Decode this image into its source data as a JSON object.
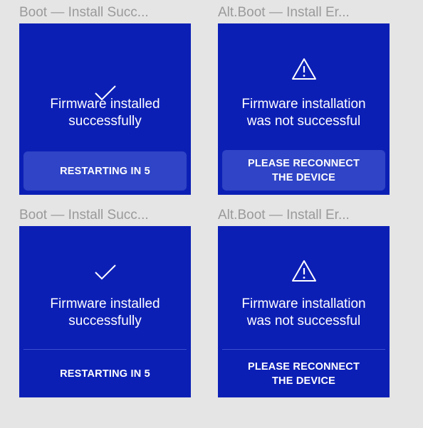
{
  "frames": [
    {
      "label": "Boot — Install Succ...",
      "icon": "checkmark-icon",
      "message_line1": "Firmware installed",
      "message_line2": "successfully",
      "action_line1": "RESTARTING IN 5",
      "action_line2": ""
    },
    {
      "label": "Alt.Boot — Install Er...",
      "icon": "warning-icon",
      "message_line1": "Firmware installation",
      "message_line2": "was not successful",
      "action_line1": "PLEASE RECONNECT",
      "action_line2": "THE DEVICE"
    },
    {
      "label": "Boot — Install Succ...",
      "icon": "checkmark-icon",
      "message_line1": "Firmware installed",
      "message_line2": "successfully",
      "action_line1": "RESTARTING IN 5",
      "action_line2": ""
    },
    {
      "label": "Alt.Boot — Install Er...",
      "icon": "warning-icon",
      "message_line1": "Firmware installation",
      "message_line2": "was not successful",
      "action_line1": "PLEASE RECONNECT",
      "action_line2": "THE DEVICE"
    }
  ],
  "colors": {
    "canvas": "#e5e5e5",
    "screen": "#0c1fb5",
    "button": "#2f44c6",
    "label": "#9a9a9a"
  }
}
